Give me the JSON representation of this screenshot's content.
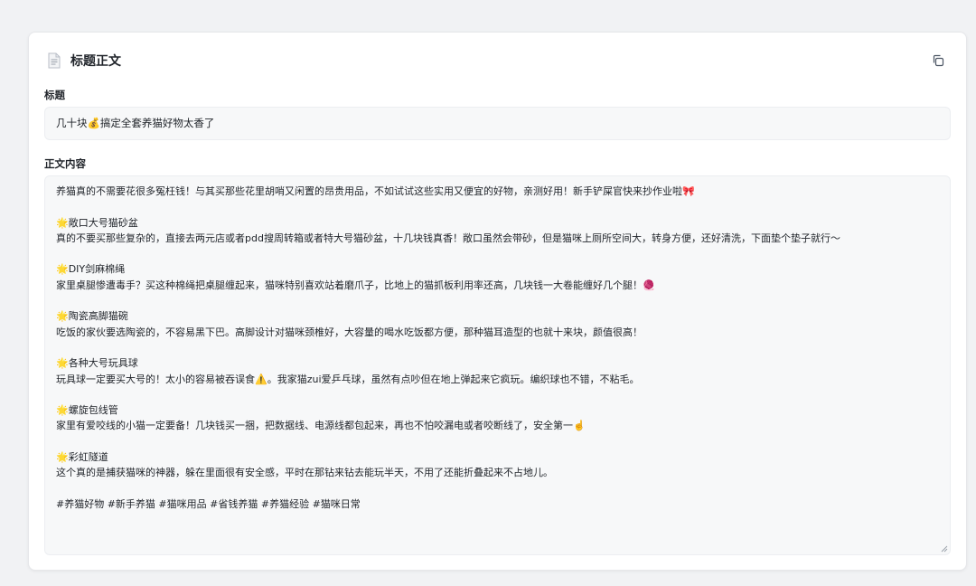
{
  "card": {
    "title": "标题正文"
  },
  "title_field": {
    "label": "标题",
    "value": "几十块💰搞定全套养猫好物太香了"
  },
  "body_field": {
    "label": "正文内容",
    "lines": [
      "养猫真的不需要花很多冤枉钱！与其买那些花里胡哨又闲置的昂贵用品，不如试试这些实用又便宜的好物，亲测好用！新手铲屎官快来抄作业啦🎀",
      "",
      "🌟敞口大号猫砂盆",
      "真的不要买那些复杂的，直接去两元店或者pdd搜周转箱或者特大号猫砂盆，十几块钱真香！敞口虽然会带砂，但是猫咪上厕所空间大，转身方便，还好清洗，下面垫个垫子就行～",
      "",
      "🌟DIY剑麻棉绳",
      "家里桌腿惨遭毒手？买这种棉绳把桌腿缠起来，猫咪特别喜欢站着磨爪子，比地上的猫抓板利用率还高，几块钱一大卷能缠好几个腿！🧶",
      "",
      "🌟陶瓷高脚猫碗",
      "吃饭的家伙要选陶瓷的，不容易黑下巴。高脚设计对猫咪颈椎好，大容量的喝水吃饭都方便，那种猫耳造型的也就十来块，颜值很高！",
      "",
      "🌟各种大号玩具球",
      "玩具球一定要买大号的！太小的容易被吞误食⚠️。我家猫zui爱乒乓球，虽然有点吵但在地上弹起来它疯玩。编织球也不错，不粘毛。",
      "",
      "🌟螺旋包线管",
      "家里有爱咬线的小猫一定要备！几块钱买一捆，把数据线、电源线都包起来，再也不怕咬漏电或者咬断线了，安全第一☝️",
      "",
      "🌟彩虹隧道",
      "这个真的是捕获猫咪的神器，躲在里面很有安全感，平时在那钻来钻去能玩半天，不用了还能折叠起来不占地儿。",
      "",
      "#养猫好物 #新手养猫 #猫咪用品 #省钱养猫 #养猫经验 #猫咪日常"
    ]
  },
  "icons": {
    "header": "document-icon",
    "copy": "copy-icon",
    "resize": "resize-handle-icon"
  }
}
